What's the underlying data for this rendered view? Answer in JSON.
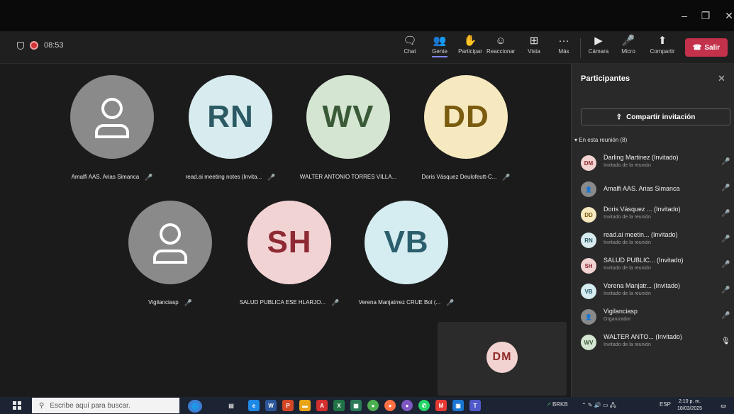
{
  "window": {
    "minimize": "–",
    "maximize": "❐",
    "close": "✕"
  },
  "toolbar": {
    "timer": "08:53",
    "chat": "Chat",
    "people": "Gente",
    "raise": "Participar",
    "react": "Reaccionar",
    "view": "Vista",
    "more": "Más",
    "camera": "Cámara",
    "mic": "Micro",
    "share": "Compartir",
    "leave": "Salir"
  },
  "tiles": [
    {
      "initials": "",
      "name": "Amalfi AAS. Arias Simanca",
      "bg": "#8a8a8a",
      "fg": "#ffffff"
    },
    {
      "initials": "RN",
      "name": "read.ai meeting notes (Invita...",
      "bg": "#d8ecef",
      "fg": "#2b5a64"
    },
    {
      "initials": "WV",
      "name": "WALTER ANTONIO TORRES VILLA...",
      "bg": "#d4e5d2",
      "fg": "#3a5a37"
    },
    {
      "initials": "DD",
      "name": "Doris Vásquez Deulofeutt-C...",
      "bg": "#f7e9bf",
      "fg": "#7a5c10"
    },
    {
      "initials": "",
      "name": "Vigilanciasp",
      "bg": "#8a8a8a",
      "fg": "#ffffff"
    },
    {
      "initials": "SH",
      "name": "SALUD PUBLICA ESE HLARJO...",
      "bg": "#f2d3d4",
      "fg": "#8e2a33"
    },
    {
      "initials": "VB",
      "name": "Verena Manjatrrez CRUE Bol (...",
      "bg": "#d5ecf1",
      "fg": "#2b5f6d"
    }
  ],
  "self": {
    "initials": "DM",
    "bg": "#f3d3d1",
    "fg": "#8e2a2a"
  },
  "panel": {
    "title": "Participantes",
    "invite": "Compartir invitación",
    "section": "En esta reunión (8)",
    "people": [
      {
        "initials": "DM",
        "name": "Darling Martinez (Invitado)",
        "sub": "Invitado de la reunión",
        "bg": "#f3d3d1",
        "fg": "#8e2a2a",
        "mic": "off"
      },
      {
        "initials": "",
        "name": "Amalfi AAS. Arias Simanca",
        "sub": "",
        "bg": "#8a8a8a",
        "fg": "#ffffff",
        "mic": "off"
      },
      {
        "initials": "DD",
        "name": "Doris Vásquez ... (Invitado)",
        "sub": "Invitado de la reunión",
        "bg": "#f7e9bf",
        "fg": "#7a5c10",
        "mic": "off"
      },
      {
        "initials": "RN",
        "name": "read.ai meetin... (Invitado)",
        "sub": "Invitado de la reunión",
        "bg": "#d8ecef",
        "fg": "#2b5a64",
        "mic": "off"
      },
      {
        "initials": "SH",
        "name": "SALUD PUBLIC... (Invitado)",
        "sub": "Invitado de la reunión",
        "bg": "#f2d3d4",
        "fg": "#8e2a33",
        "mic": "off"
      },
      {
        "initials": "VB",
        "name": "Verena Manjatr... (Invitado)",
        "sub": "Invitado de la reunión",
        "bg": "#d5ecf1",
        "fg": "#2b5f6d",
        "mic": "off"
      },
      {
        "initials": "",
        "name": "Vigilanciasp",
        "sub": "Organizador",
        "bg": "#8a8a8a",
        "fg": "#ffffff",
        "mic": "off"
      },
      {
        "initials": "WV",
        "name": "WALTER ANTO... (Invitado)",
        "sub": "Invitado de la reunión",
        "bg": "#d4e5d2",
        "fg": "#3a5a37",
        "mic": "on"
      }
    ]
  },
  "taskbar": {
    "search_placeholder": "Escribe aquí para buscar.",
    "stock": "BRKB",
    "lang": "ESP",
    "time": "2:10 p. m.",
    "date": "18/03/2025"
  }
}
